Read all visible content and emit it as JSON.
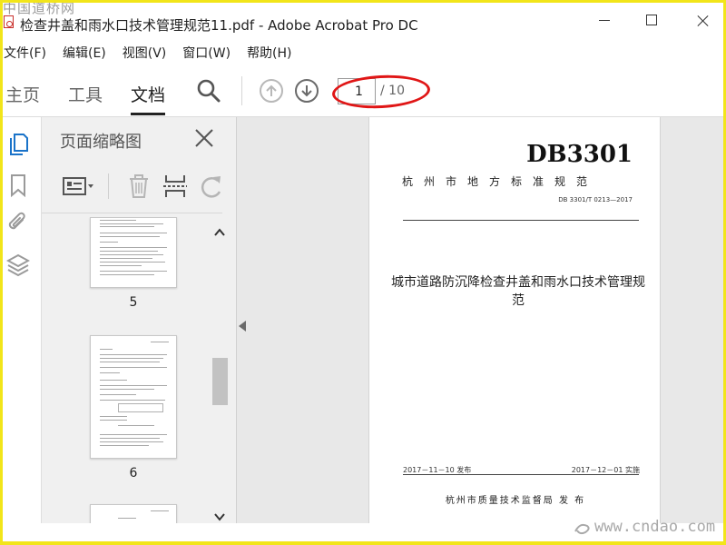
{
  "window": {
    "title": "检查井盖和雨水口技术管理规范11.pdf - Adobe Acrobat Pro DC",
    "watermark_top": "中国道桥网",
    "watermark_bottom": "www.cndao.com"
  },
  "menubar": {
    "items": [
      "文件(F)",
      "编辑(E)",
      "视图(V)",
      "窗口(W)",
      "帮助(H)"
    ]
  },
  "toolbar": {
    "tabs": [
      "主页",
      "工具",
      "文档"
    ],
    "active_tab": "文档",
    "current_page": "1",
    "total_pages": "/ 10",
    "highlight_color": "#e01616"
  },
  "thumbnails_panel": {
    "title": "页面缩略图",
    "thumbnails": [
      {
        "label": "5"
      },
      {
        "label": "6"
      }
    ]
  },
  "document": {
    "std_code": "DB3301",
    "category": "杭州市地方标准规范",
    "number": "DB 3301/T 0213—2017",
    "main_title": "城市道路防沉降检查井盖和雨水口技术管理规范",
    "publish_date": "2017－11－10 发布",
    "effective_date": "2017－12－01 实施",
    "issuer": "杭州市质量技术监督局   发 布"
  }
}
